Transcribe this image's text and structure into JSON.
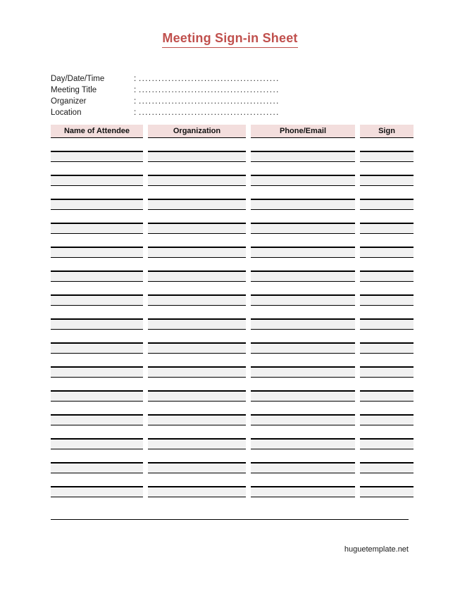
{
  "document": {
    "title": "Meeting Sign-in Sheet"
  },
  "meta_fields": [
    {
      "label": "Day/Date/Time",
      "separator": ":",
      "value": "",
      "dots": "..........................................."
    },
    {
      "label": "Meeting Title",
      "separator": ":",
      "value": "",
      "dots": "..........................................."
    },
    {
      "label": "Organizer",
      "separator": ":",
      "value": "",
      "dots": "..........................................."
    },
    {
      "label": "Location",
      "separator": ":",
      "value": "",
      "dots": "..........................................."
    }
  ],
  "table": {
    "columns": [
      {
        "header": "Name of Attendee"
      },
      {
        "header": "Organization"
      },
      {
        "header": "Phone/Email"
      },
      {
        "header": "Sign"
      }
    ],
    "row_count": 15,
    "rows": [
      {
        "name": "",
        "organization": "",
        "phone_email": "",
        "sign": ""
      },
      {
        "name": "",
        "organization": "",
        "phone_email": "",
        "sign": ""
      },
      {
        "name": "",
        "organization": "",
        "phone_email": "",
        "sign": ""
      },
      {
        "name": "",
        "organization": "",
        "phone_email": "",
        "sign": ""
      },
      {
        "name": "",
        "organization": "",
        "phone_email": "",
        "sign": ""
      },
      {
        "name": "",
        "organization": "",
        "phone_email": "",
        "sign": ""
      },
      {
        "name": "",
        "organization": "",
        "phone_email": "",
        "sign": ""
      },
      {
        "name": "",
        "organization": "",
        "phone_email": "",
        "sign": ""
      },
      {
        "name": "",
        "organization": "",
        "phone_email": "",
        "sign": ""
      },
      {
        "name": "",
        "organization": "",
        "phone_email": "",
        "sign": ""
      },
      {
        "name": "",
        "organization": "",
        "phone_email": "",
        "sign": ""
      },
      {
        "name": "",
        "organization": "",
        "phone_email": "",
        "sign": ""
      },
      {
        "name": "",
        "organization": "",
        "phone_email": "",
        "sign": ""
      },
      {
        "name": "",
        "organization": "",
        "phone_email": "",
        "sign": ""
      },
      {
        "name": "",
        "organization": "",
        "phone_email": "",
        "sign": ""
      }
    ]
  },
  "footer": {
    "text": "huguetemplate.net"
  },
  "colors": {
    "title": "#c0504d",
    "header_fill": "#f3dedd",
    "row_alt_fill": "#f1f1f1",
    "rule": "#000000",
    "text": "#1a1a1a"
  }
}
